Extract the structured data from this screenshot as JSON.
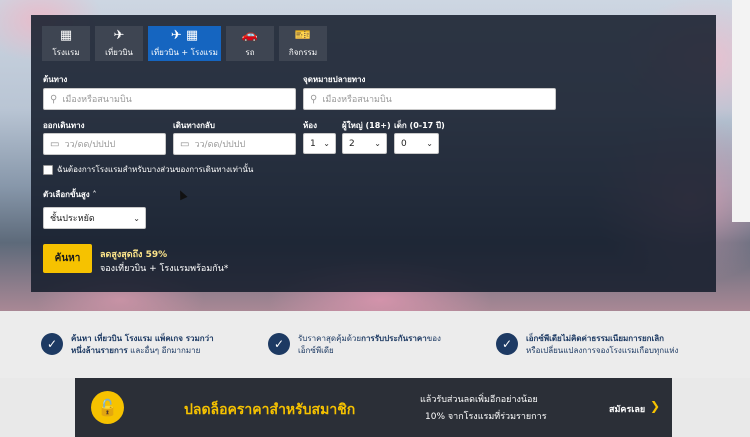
{
  "tabs": [
    {
      "label": "โรงแรม",
      "icon": "building-icon",
      "glyph": "▦"
    },
    {
      "label": "เที่ยวบิน",
      "icon": "plane-icon",
      "glyph": "✈"
    },
    {
      "label": "เที่ยวบิน + โรงแรม",
      "icon": "plane-building-icon",
      "glyph": "✈ ▦"
    },
    {
      "label": "รถ",
      "icon": "car-icon",
      "glyph": "🚗"
    },
    {
      "label": "กิจกรรม",
      "icon": "ticket-icon",
      "glyph": "🎫"
    }
  ],
  "active_tab": "เที่ยวบิน + โรงแรม",
  "origin": {
    "label": "ต้นทาง",
    "placeholder": "เมืองหรือสนามบิน"
  },
  "destination": {
    "label": "จุดหมายปลายทาง",
    "placeholder": "เมืองหรือสนามบิน"
  },
  "depart": {
    "label": "ออกเดินทาง",
    "placeholder": "วว/ดด/ปปปป"
  },
  "return": {
    "label": "เดินทางกลับ",
    "placeholder": "วว/ดด/ปปปป"
  },
  "rooms": {
    "label": "ห้อง",
    "value": "1"
  },
  "adults": {
    "label": "ผู้ใหญ่ (18+)",
    "value": "2"
  },
  "children": {
    "label": "เด็ก (0-17 ปี)",
    "value": "0"
  },
  "partial_hotel_checkbox": "ฉันต้องการโรงแรมสำหรับบางส่วนของการเดินทางเท่านั้น",
  "advanced_options": {
    "label": "ตัวเลือกขั้นสูง ˄",
    "class_value": "ชั้นประหยัด"
  },
  "search_button": "ค้นหา",
  "promo": {
    "line1": "ลดสูงสุดถึง 59%",
    "line2": "จองเที่ยวบิน + โรงแรมพร้อมกัน*"
  },
  "benefits": [
    {
      "line1_bold": "ค้นหา เที่ยวบิน โรงแรม แพ็คเกจ รวมกว่า",
      "line2_bold": "หนึ่งล้านรายการ",
      "line2_rest": " และอื่นๆ อีกมากมาย"
    },
    {
      "line1_pre": "รับราคาสุดคุ้มด้วย",
      "line1_bold": "การรับประกันราคา",
      "line1_post": "ของ",
      "line2": "เอ็กซ์พีเดีย"
    },
    {
      "line1_bold": "เอ็กซ์พีเดียไม่คิดค่าธรรมเนียมการยกเลิก",
      "line2": "หรือเปลี่ยนแปลงการจองโรงแรมเกือบทุกแห่ง"
    }
  ],
  "member_banner": {
    "title": "ปลดล็อคราคาสำหรับสมาชิก",
    "sub1": "แล้วรับส่วนลดเพิ่มอีกอย่างน้อย",
    "sub2": "10% จากโรงแรมที่ร่วมรายการ",
    "link": "สมัครเลย",
    "chevron": "❯"
  },
  "colors": {
    "accent": "#f6c200",
    "active_tab": "#1565c0",
    "navy": "#1d3a63"
  }
}
